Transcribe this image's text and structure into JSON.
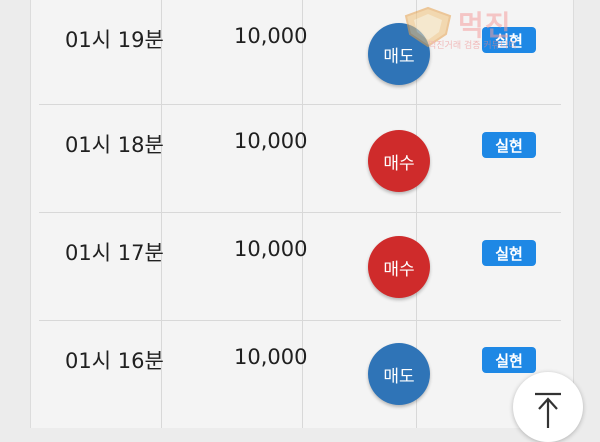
{
  "colors": {
    "sell": "#2f74b7",
    "buy": "#cf2b2b",
    "badge": "#1e88e5"
  },
  "rows": [
    {
      "time": "01시 19분",
      "price": "10,000",
      "side": "매도",
      "side_type": "sell",
      "status": "실현"
    },
    {
      "time": "01시 18분",
      "price": "10,000",
      "side": "매수",
      "side_type": "buy",
      "status": "실현"
    },
    {
      "time": "01시 17분",
      "price": "10,000",
      "side": "매수",
      "side_type": "buy",
      "status": "실현"
    },
    {
      "time": "01시 16분",
      "price": "10,000",
      "side": "매도",
      "side_type": "sell",
      "status": "실현"
    }
  ],
  "watermark": {
    "brand": "먹진",
    "tagline": "먹진거래 검증 커뮤니티"
  },
  "scroll_top_icon": "arrow-up-to-top-icon"
}
